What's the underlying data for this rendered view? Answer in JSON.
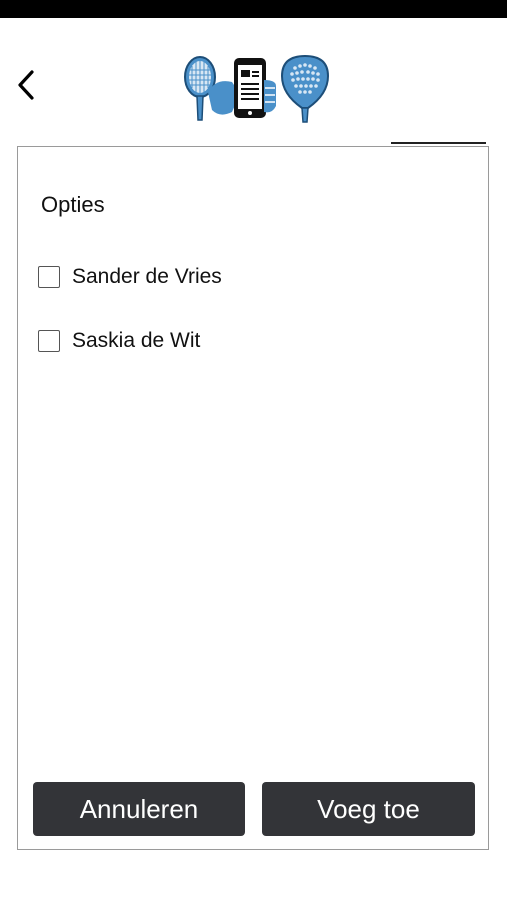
{
  "dialog": {
    "title": "Opties",
    "options": [
      {
        "label": "Sander de Vries",
        "checked": false
      },
      {
        "label": "Saskia de Wit",
        "checked": false
      }
    ],
    "cancel_label": "Annuleren",
    "add_label": "Voeg toe"
  },
  "icons": {
    "back": "chevron-left-icon",
    "logo": "padel-app-logo"
  },
  "colors": {
    "button_bg": "#333438",
    "logo_blue": "#4a90c9",
    "status_bar": "#000000"
  }
}
